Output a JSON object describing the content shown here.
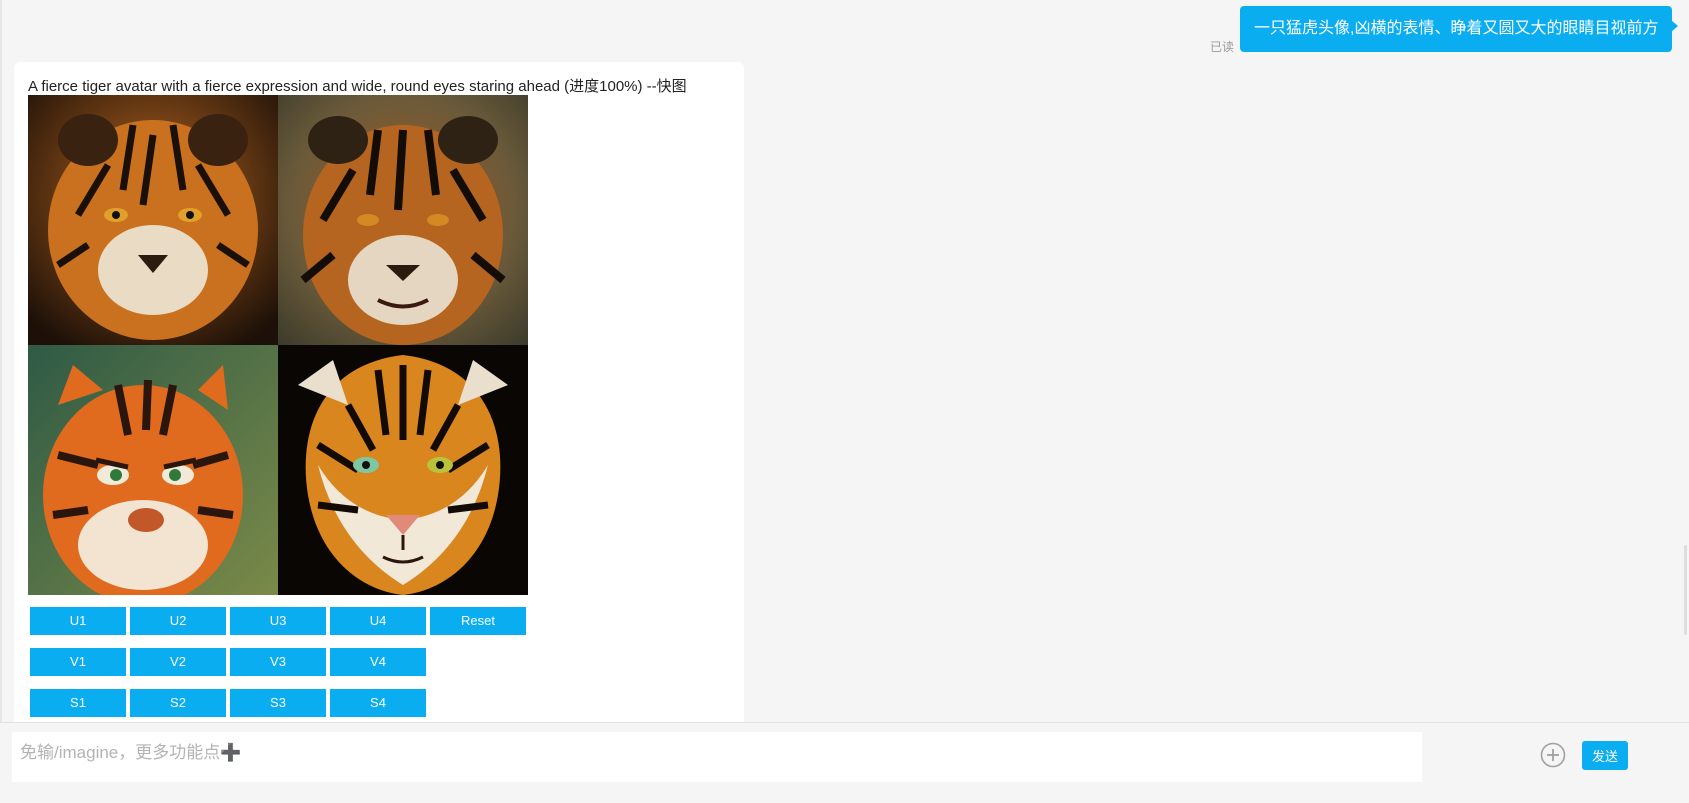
{
  "chat": {
    "user_message": {
      "read_status": "已读",
      "text": "一只猛虎头像,凶横的表情、睁着又圆又大的眼睛目视前方"
    },
    "bot_message": {
      "text": "A fierce tiger avatar with a fierce expression and wide, round eyes staring ahead (进度100%) --快图",
      "image_tiles": [
        {
          "icon": "tiger-photo-1"
        },
        {
          "icon": "tiger-photo-2"
        },
        {
          "icon": "tiger-cartoon-3"
        },
        {
          "icon": "tiger-illustration-4"
        }
      ],
      "upscale_buttons": [
        "U1",
        "U2",
        "U3",
        "U4",
        "Reset"
      ],
      "variation_buttons": [
        "V1",
        "V2",
        "V3",
        "V4"
      ],
      "s_buttons": [
        "S1",
        "S2",
        "S3",
        "S4"
      ]
    }
  },
  "composer": {
    "placeholder": "免输/imagine，更多功能点➕",
    "value": "",
    "plus_icon": "plus-circle-icon",
    "send_label": "发送"
  },
  "colors": {
    "accent": "#0aaef0",
    "background": "#f5f5f5",
    "card": "#ffffff"
  }
}
